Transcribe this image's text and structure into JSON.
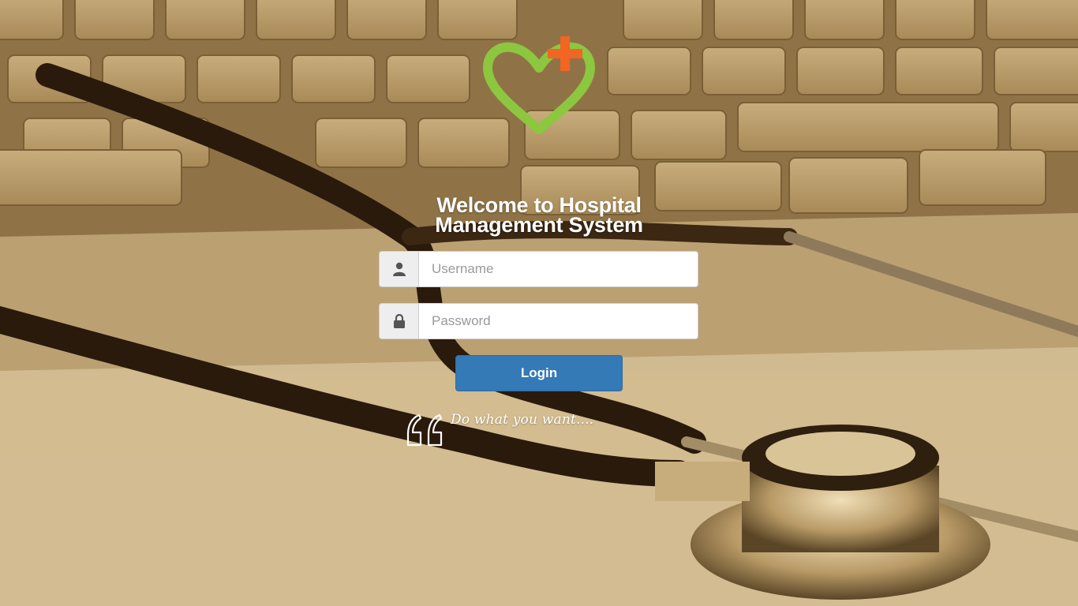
{
  "page": {
    "title_line1": "Welcome to Hospital",
    "title_line2": "Management System"
  },
  "logo": {
    "icon": "heart-plus-icon",
    "heart_color": "#8dc63f",
    "plus_color": "#f26522"
  },
  "login_form": {
    "username": {
      "icon": "user-icon",
      "placeholder": "Username",
      "value": ""
    },
    "password": {
      "icon": "lock-icon",
      "placeholder": "Password",
      "value": ""
    },
    "submit_label": "Login",
    "button_color": "#337ab7"
  },
  "quote": {
    "icon": "quote-icon",
    "text": "Do what you want...."
  },
  "background": {
    "tint": "#a9895a"
  }
}
